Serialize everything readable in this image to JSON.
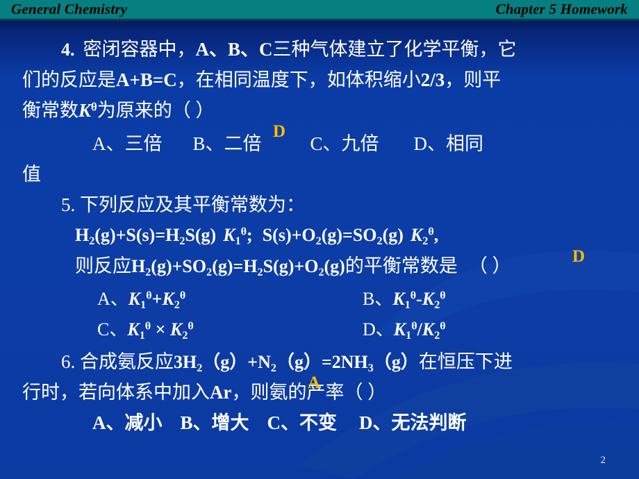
{
  "header": {
    "left_title": "General Chemistry",
    "right_title": "Chapter 5   Homework",
    "band_color": "#067f80"
  },
  "theme": {
    "background_top": "#030d2e",
    "background_main": "#0c3da6",
    "text_color": "#ffffff",
    "answer_color": "#ffc000"
  },
  "questions": [
    {
      "number": "4.",
      "line1_a": "4.",
      "line1_b": "密闭容器中，",
      "line1_c": "A、B、C",
      "line1_d": "三种气体建立了化学平衡，它",
      "line2_a": "们的反应是",
      "line2_b": "A+B=C",
      "line2_c": "，在相同温度下，如体积缩小",
      "line2_d": "2/3",
      "line2_e": "，则平",
      "line3_a": "衡常数",
      "line3_K": "K",
      "line3_theta": "θ",
      "line3_b": "为原来的",
      "line3_paren": "（        ）",
      "options": [
        {
          "label": "A、三倍"
        },
        {
          "label": "B、二倍"
        },
        {
          "label": "C、九倍"
        },
        {
          "label": "D、相同"
        }
      ],
      "options_tail": "值",
      "answer": "D"
    },
    {
      "number": "5.",
      "stem": "5.   下列反应及其平衡常数为：",
      "eq_line": {
        "r1_pre": "H",
        "r1_sub1": "2",
        "r1_mid": "(g)+S(s)=H",
        "r1_sub2": "2",
        "r1_post": "S(g)",
        "K1": "K",
        "K1_sub": "1",
        "K1_sup": "θ",
        "semicolon": ";",
        "r2_pre": "S(s)+O",
        "r2_sub1": "2",
        "r2_mid": "(g)=SO",
        "r2_sub2": "2",
        "r2_post": "(g)",
        "K2": "K",
        "K2_sub": "2",
        "K2_sup": "θ",
        "comma": ","
      },
      "ask_line": {
        "pre": "则反应",
        "f1": "H",
        "f1s": "2",
        "f2": "(g)+SO",
        "f2s": "2",
        "f3": "(g)=H",
        "f3s": "2",
        "f4": "S(g)+O",
        "f4s": "2",
        "f5": "(g)",
        "post": "的平衡常数是",
        "paren": "（          ）"
      },
      "options": [
        {
          "prefix": "A、",
          "K1": "K",
          "K1sub": "1",
          "K1sup": "θ",
          "op": "+",
          "K2": "K",
          "K2sub": "2",
          "K2sup": "θ"
        },
        {
          "prefix": "B、",
          "K1": "K",
          "K1sub": "1",
          "K1sup": "θ",
          "op": "-",
          "K2": "K",
          "K2sub": "2",
          "K2sup": "θ"
        },
        {
          "prefix": "C、",
          "K1": "K",
          "K1sub": "1",
          "K1sup": "θ",
          "op": " × ",
          "K2": "K",
          "K2sub": "2",
          "K2sup": "θ"
        },
        {
          "prefix": "D、",
          "K1": "K",
          "K1sub": "1",
          "K1sup": "θ",
          "op": "/",
          "K2": "K",
          "K2sub": "2",
          "K2sup": "θ"
        }
      ],
      "answer": "D"
    },
    {
      "number": "6.",
      "line1_a": "6.   合成氨反应",
      "line1_b": "3H",
      "line1_b_sub": "2",
      "line1_c": "（g）+N",
      "line1_c_sub": "2",
      "line1_d": "（g）=2NH",
      "line1_d_sub": "3",
      "line1_e": "（g）",
      "line1_f": "在恒压下进",
      "line2_a": "行时，若向体系中加入",
      "line2_b": "Ar",
      "line2_c": "，则氨的产率（   ）",
      "options": [
        {
          "label": "A、减小"
        },
        {
          "label": "B、增大"
        },
        {
          "label": "C、不变"
        },
        {
          "label": "D、无法判断"
        }
      ],
      "answer": "A"
    }
  ],
  "footer": {
    "page_number": "2"
  }
}
